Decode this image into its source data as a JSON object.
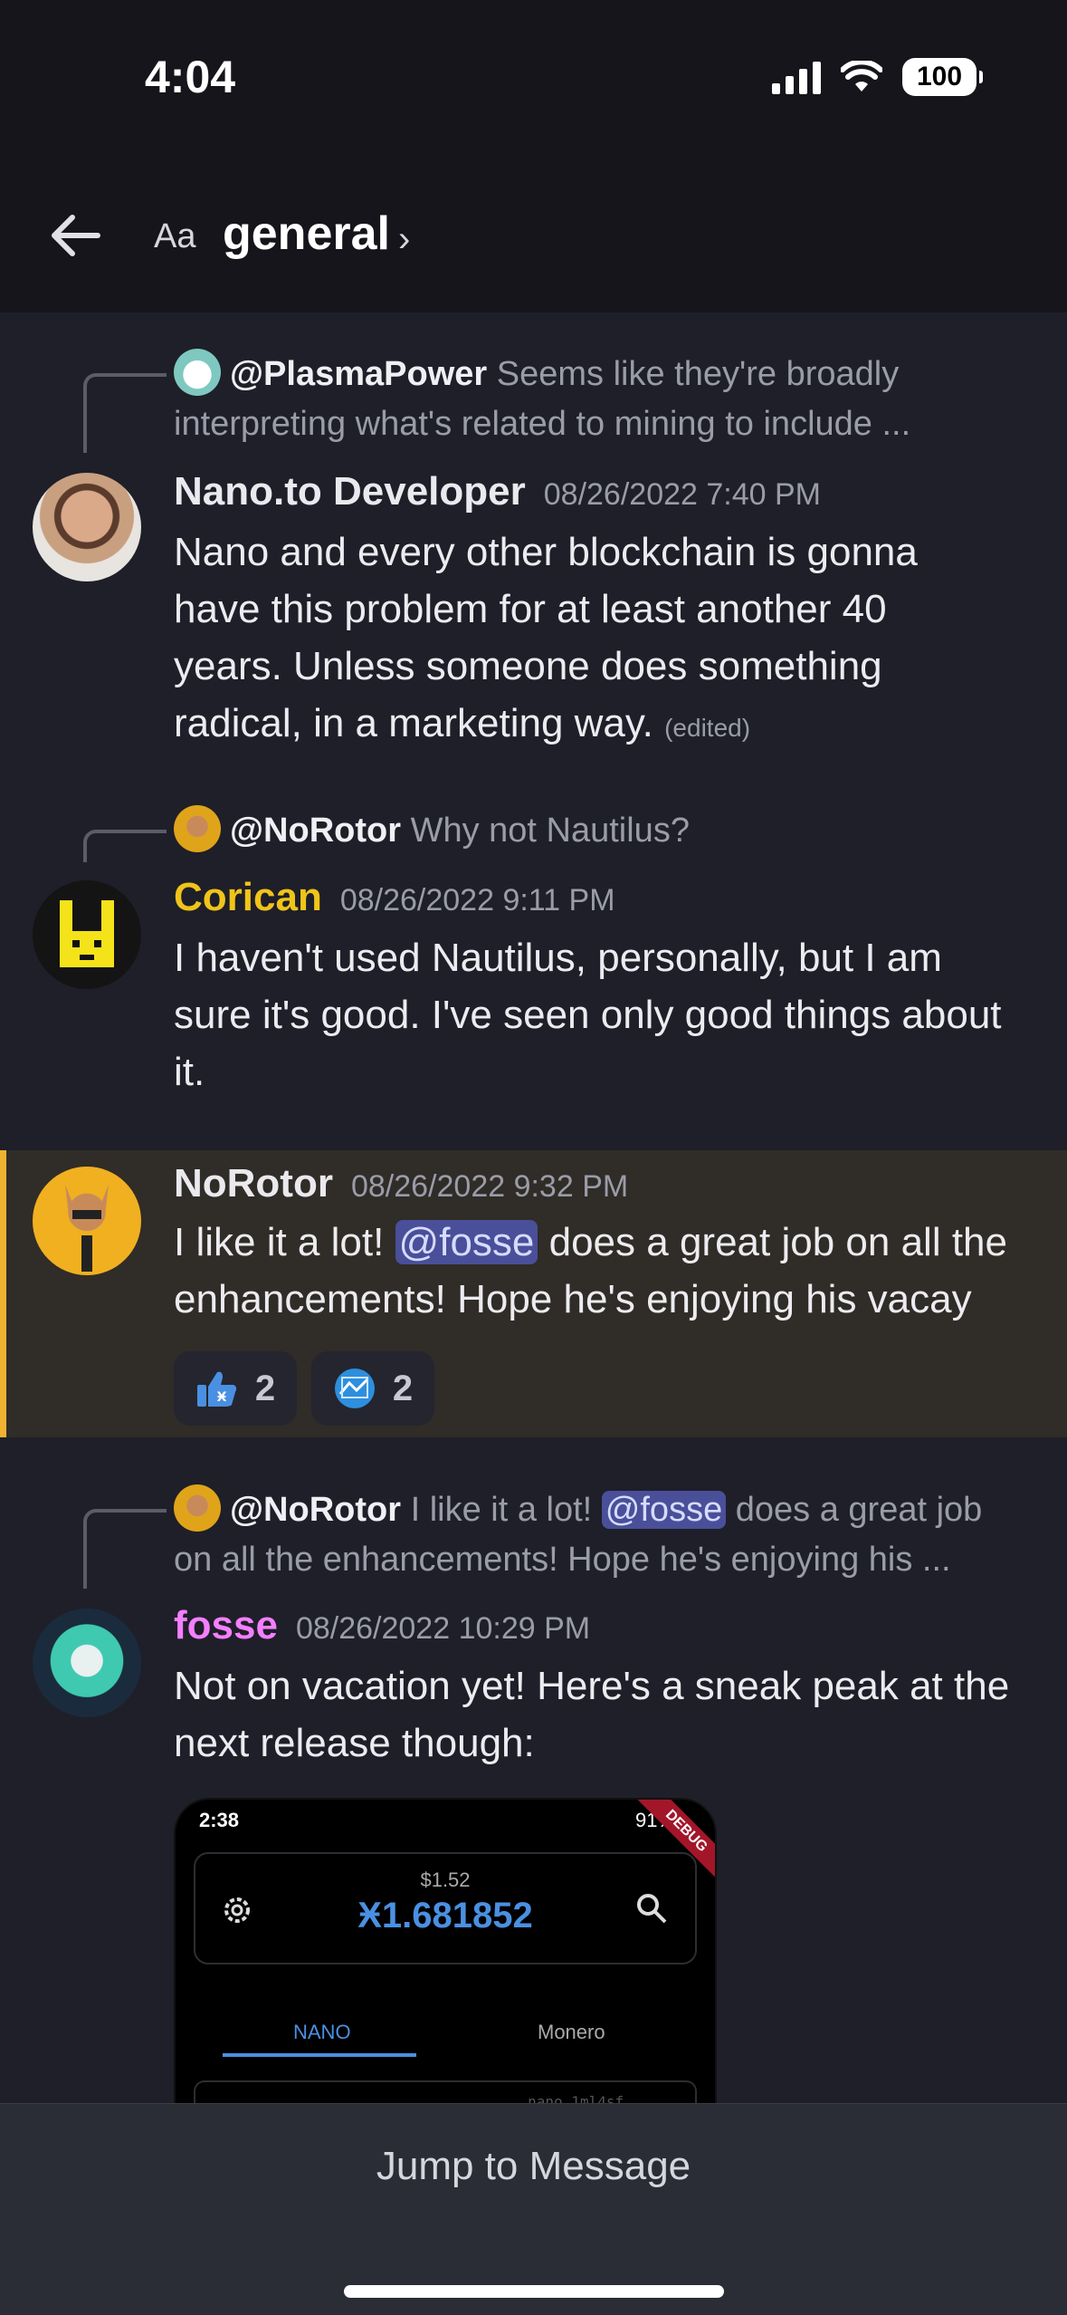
{
  "status": {
    "time": "4:04",
    "battery": "100"
  },
  "header": {
    "aa_label": "Aa",
    "channel": "general",
    "chevron": "›"
  },
  "messages": [
    {
      "reply_to": "@PlasmaPower",
      "reply_text_line1": "Seems like they're broadly",
      "reply_text_line2": "interpreting what's related to mining to include ...",
      "author": "Nano.to Developer",
      "author_color": "#f0f0f4",
      "timestamp": "08/26/2022 7:40 PM",
      "lines": [
        "Nano and every other blockchain is gonna",
        "have this problem for at least another 40",
        "years. Unless someone does something",
        "radical, in a marketing way."
      ],
      "edited": "(edited)"
    },
    {
      "reply_to": "@NoRotor",
      "reply_text_line1": "Why not Nautilus?",
      "author": "Corican",
      "author_color": "#f0c419",
      "timestamp": "08/26/2022 9:11 PM",
      "lines": [
        "I haven't used Nautilus, personally, but I am",
        "sure it's good. I've seen only good things about",
        "it."
      ]
    },
    {
      "author": "NoRotor",
      "author_color": "#f0f0f4",
      "timestamp": "08/26/2022 9:32 PM",
      "line1_before": "I like it a lot! ",
      "mention": "@fosse",
      "line1_after": " does a great job on all the",
      "line2": "enhancements! Hope he's enjoying his vacay",
      "reactions": [
        {
          "icon": "thumbs-up-nano-icon",
          "count": "2"
        },
        {
          "icon": "nano-logo-icon",
          "count": "2"
        }
      ]
    },
    {
      "reply_to": "@NoRotor",
      "reply_text_before": "I like it a lot! ",
      "reply_mention": "@fosse",
      "reply_text_after": " does a great job",
      "reply_text_line2": "on all the enhancements! Hope he's enjoying his ...",
      "author": "fosse",
      "author_color": "#f47fff",
      "timestamp": "08/26/2022 10:29 PM",
      "lines": [
        "Not on vacation yet! Here's a sneak peak at the",
        "next release though:"
      ]
    }
  ],
  "attachment": {
    "time": "2:38",
    "battery": "91%",
    "ribbon": "DEBUG",
    "fiat": "$1.52",
    "balance": "Ӿ1.681852",
    "tabs": [
      "NANO",
      "Monero"
    ],
    "address_prefix": "nano_1ml4sf..."
  },
  "footer": {
    "jump_label": "Jump to Message"
  }
}
